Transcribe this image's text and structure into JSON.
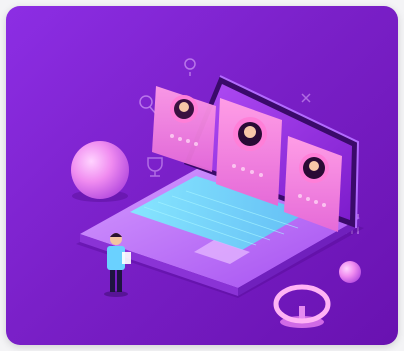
{
  "card": {
    "illustration": "isometric-laptop-with-user-profile-cards",
    "accent_color": "#8a2be2",
    "icons": [
      "laptop-icon",
      "profile-card-icon",
      "person-icon",
      "magnifier-icon",
      "trophy-icon",
      "location-pin-icon",
      "bar-chart-icon",
      "sphere-icon",
      "ring-stand-icon"
    ]
  }
}
